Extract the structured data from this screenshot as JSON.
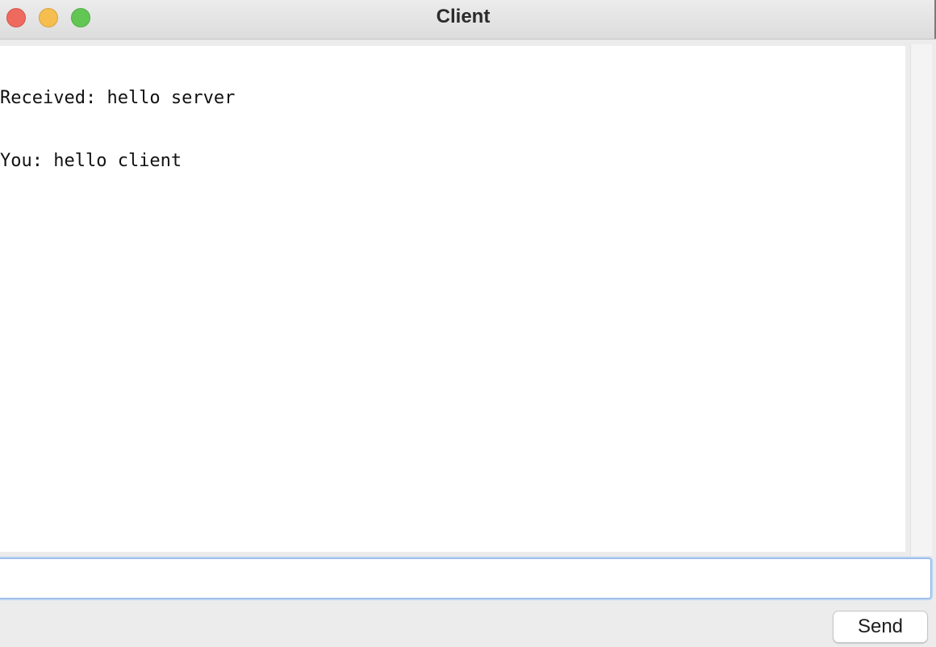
{
  "window": {
    "title": "Client"
  },
  "log": {
    "lines": [
      "Received: hello server",
      "You: hello client"
    ]
  },
  "input": {
    "value": ""
  },
  "actions": {
    "send_label": "Send"
  }
}
